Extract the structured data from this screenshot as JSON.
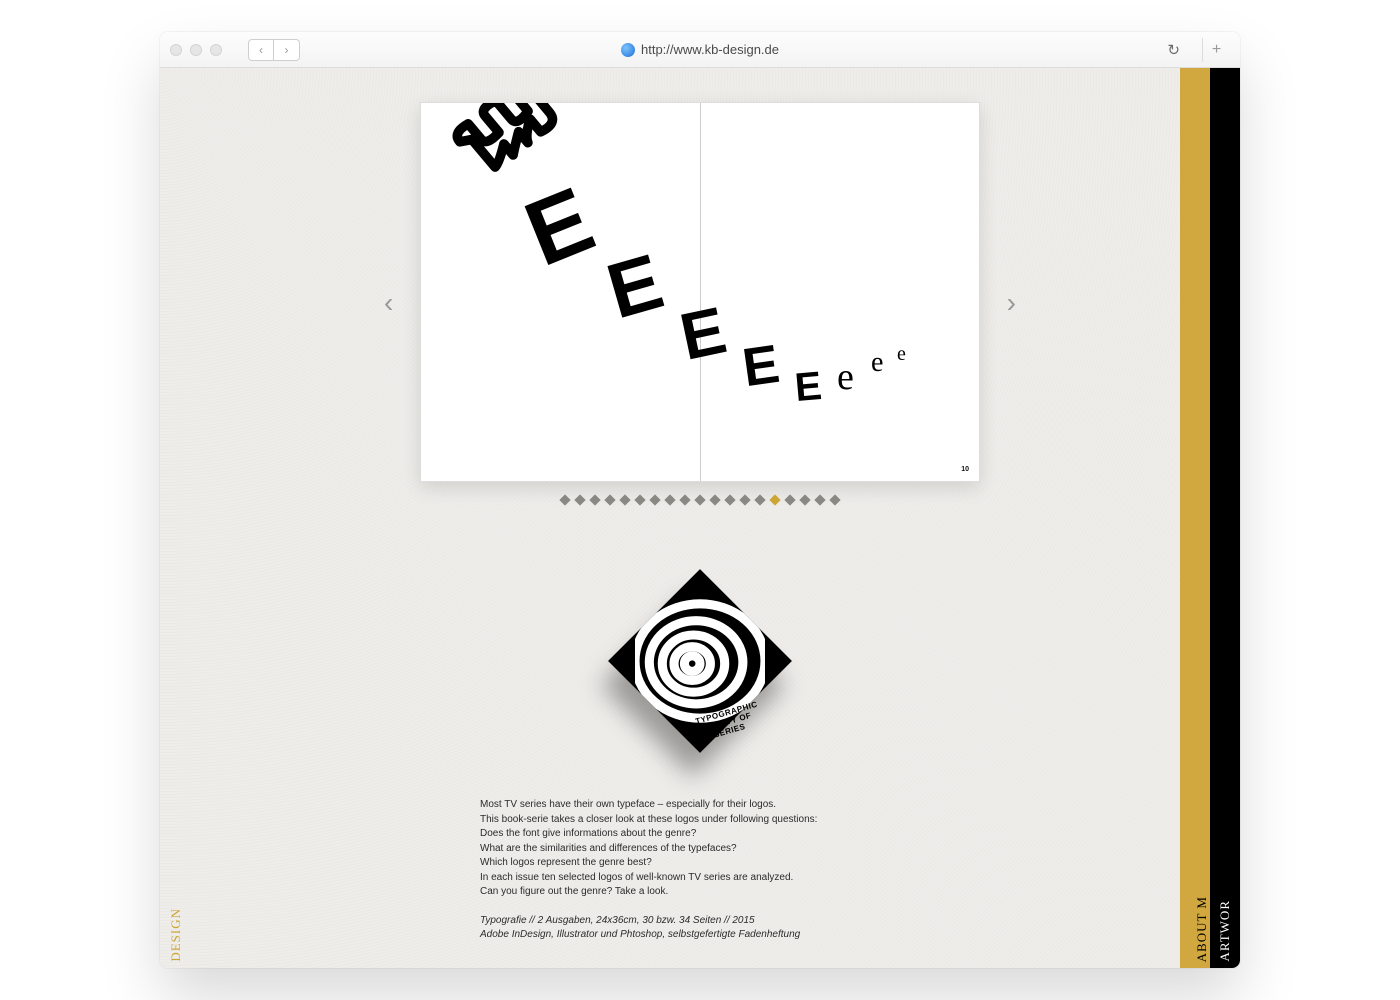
{
  "browser": {
    "url": "http://www.kb-design.de",
    "nav_back": "‹",
    "nav_fwd": "›",
    "refresh": "↻",
    "newtab": "+"
  },
  "left_tab": "DESIGN",
  "right_rail": {
    "gold": "ABOUT M",
    "black": "ARTWOR"
  },
  "carousel": {
    "page_number": "10",
    "dot_count": 19,
    "active_dot": 14
  },
  "diamond": {
    "label_line1": "TYPOGRAPHIC",
    "label_line2": "IDENTITY OF",
    "label_line3": "TV-SERIES"
  },
  "letters": {
    "e1": "E",
    "e2": "E",
    "e3": "E",
    "e4": "E",
    "e5": "E",
    "el1": "e",
    "el2": "e",
    "el3": "e"
  },
  "desc": {
    "p1": "Most TV series have their own typeface – especially for their logos.",
    "p2": "This book-serie takes a closer look at these logos under following questions:",
    "p3": "Does the font give informations about the genre?",
    "p4": "What are the similarities and differences of the typefaces?",
    "p5": "Which logos represent the genre best?",
    "p6": "In each issue ten selected logos of well-known TV series are analyzed.",
    "p7": "Can you figure out the genre? Take a look.",
    "meta1": "Typografie // 2 Ausgaben, 24x36cm, 30 bzw. 34 Seiten // 2015",
    "meta2": "Adobe InDesign, Illustrator und Phtoshop, selbstgefertigte Fadenheftung"
  }
}
